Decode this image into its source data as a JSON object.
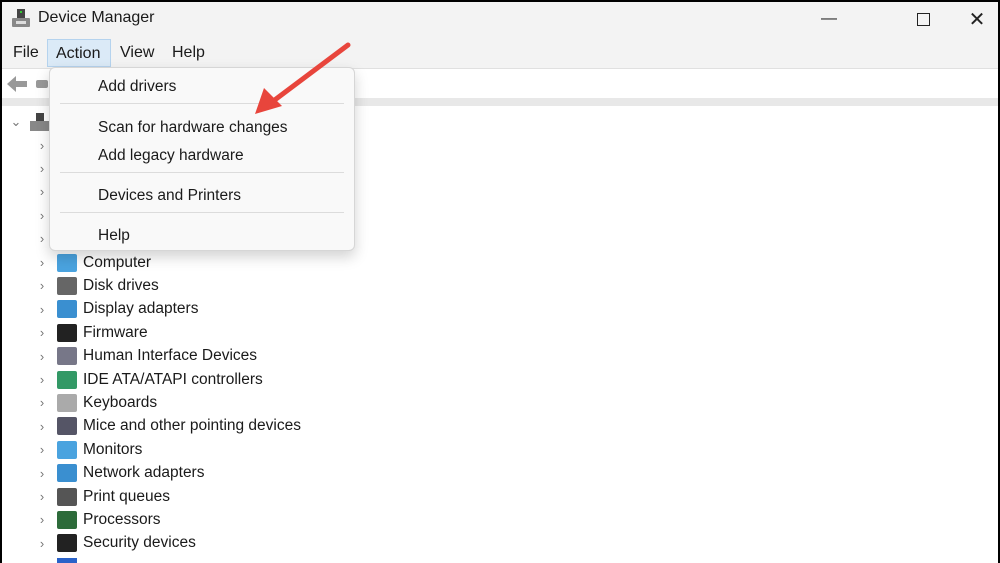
{
  "window": {
    "title": "Device Manager",
    "controls": [
      "minimize",
      "maximize",
      "close"
    ]
  },
  "menubar": {
    "items": [
      "File",
      "Action",
      "View",
      "Help"
    ],
    "active": "Action"
  },
  "action_menu": {
    "items": [
      "Add drivers",
      "Scan for hardware changes",
      "Add legacy hardware",
      "Devices and Printers",
      "Help"
    ]
  },
  "tree": {
    "items": [
      {
        "label": "Computer",
        "icon": "computer-icon"
      },
      {
        "label": "Disk drives",
        "icon": "disk-drive-icon"
      },
      {
        "label": "Display adapters",
        "icon": "display-adapter-icon"
      },
      {
        "label": "Firmware",
        "icon": "firmware-icon"
      },
      {
        "label": "Human Interface Devices",
        "icon": "hid-icon"
      },
      {
        "label": "IDE ATA/ATAPI controllers",
        "icon": "ide-controller-icon"
      },
      {
        "label": "Keyboards",
        "icon": "keyboard-icon"
      },
      {
        "label": "Mice and other pointing devices",
        "icon": "mouse-icon"
      },
      {
        "label": "Monitors",
        "icon": "monitor-icon"
      },
      {
        "label": "Network adapters",
        "icon": "network-adapter-icon"
      },
      {
        "label": "Print queues",
        "icon": "printer-icon"
      },
      {
        "label": "Processors",
        "icon": "processor-icon"
      },
      {
        "label": "Security devices",
        "icon": "security-device-icon"
      }
    ]
  },
  "colors": {
    "arrow": "#e8453c",
    "menu_active": "#dbeaf7"
  }
}
